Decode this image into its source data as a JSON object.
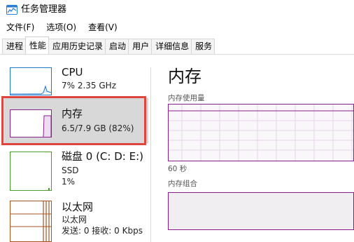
{
  "window": {
    "title": "任务管理器"
  },
  "menu": {
    "items": [
      "文件(F)",
      "选项(O)",
      "查看(V)"
    ]
  },
  "tabs": {
    "items": [
      "进程",
      "性能",
      "应用历史记录",
      "启动",
      "用户",
      "详细信息",
      "服务"
    ],
    "active": "性能"
  },
  "sidebar": {
    "items": [
      {
        "name": "CPU",
        "detail": "7% 2.35 GHz",
        "color": "#1f77c9"
      },
      {
        "name": "内存",
        "detail": "6.5/7.9 GB (82%)",
        "color": "#8b1f8e",
        "selected": true
      },
      {
        "name": "磁盘 0 (C: D: E:)",
        "detail_line1": "SSD",
        "detail_line2": "1%",
        "color": "#4c9a2a"
      },
      {
        "name": "以太网",
        "detail_line1": "以太网",
        "detail_line2": "发送: 0 接收: 0 Kbps",
        "color": "#a7531f"
      }
    ]
  },
  "main": {
    "title": "内存",
    "usage_label": "内存使用量",
    "time_label": "60 秒",
    "composition_label": "内存组合",
    "accent_color": "#8b1f8e"
  }
}
